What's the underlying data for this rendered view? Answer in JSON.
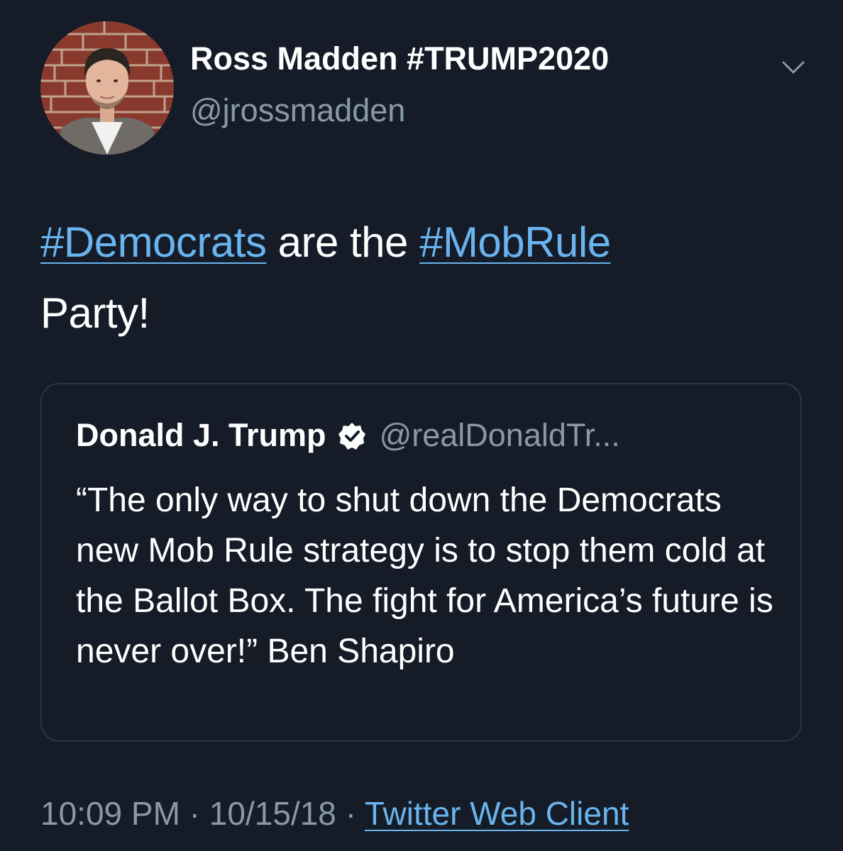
{
  "tweet": {
    "author": {
      "display_name": "Ross Madden #TRUMP2020",
      "handle": "@jrossmadden"
    },
    "more_icon": "chevron-down-icon",
    "text": {
      "hashtag_1": "#Democrats",
      "middle": " are the ",
      "hashtag_2": "#MobRule",
      "end": "Party!"
    },
    "quoted": {
      "display_name": "Donald J. Trump",
      "verified_icon": "verified-badge-icon",
      "handle": "@realDonaldTr...",
      "body": "“The only way to shut down the Democrats new Mob Rule strategy is to stop them cold at the Ballot Box. The fight for America’s future is never over!” Ben Shapiro"
    },
    "meta": {
      "time": "10:09 PM",
      "separator_1": " · ",
      "date": "10/15/18",
      "separator_2": " · ",
      "client": "Twitter Web Client"
    }
  },
  "colors": {
    "background": "#151c28",
    "link": "#69b4ee",
    "secondary_text": "#8899a6",
    "border": "#2c3644"
  }
}
